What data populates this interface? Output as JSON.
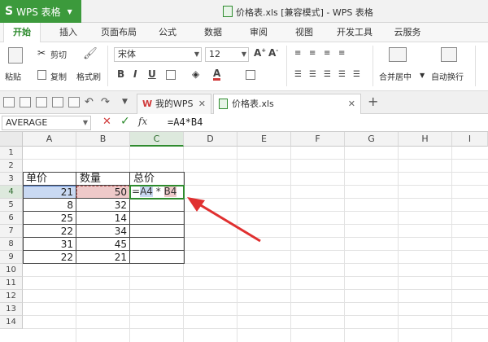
{
  "app": {
    "name": "WPS 表格",
    "window_title": "价格表.xls [兼容模式] - WPS 表格"
  },
  "ribbon_tabs": [
    "开始",
    "插入",
    "页面布局",
    "公式",
    "数据",
    "审阅",
    "视图",
    "开发工具",
    "云服务"
  ],
  "toolbar": {
    "cut": "剪切",
    "paste": "粘贴",
    "copy": "复制",
    "format_painter": "格式刷",
    "font_name": "宋体",
    "font_size": "12",
    "bold": "B",
    "italic": "I",
    "underline": "U",
    "merge_center": "合并居中",
    "wrap_text": "自动换行"
  },
  "doc_tabs": {
    "home": "我的WPS",
    "file": "价格表.xls"
  },
  "formula_bar": {
    "name_box": "AVERAGE",
    "cancel": "✕",
    "confirm": "✓",
    "fx": "fx",
    "formula": "=A4*B4"
  },
  "columns": [
    "A",
    "B",
    "C",
    "D",
    "E",
    "F",
    "G",
    "H",
    "I"
  ],
  "rows": [
    "1",
    "2",
    "3",
    "4",
    "5",
    "6",
    "7",
    "8",
    "9",
    "10",
    "11",
    "12",
    "13",
    "14"
  ],
  "table": {
    "headers": [
      "单价",
      "数量",
      "总价"
    ],
    "data": [
      [
        "21",
        "50"
      ],
      [
        "8",
        "32"
      ],
      [
        "25",
        "14"
      ],
      [
        "22",
        "34"
      ],
      [
        "31",
        "45"
      ],
      [
        "22",
        "21"
      ]
    ],
    "editing_formula": {
      "prefix": "=",
      "ref_a": "A4",
      "op": " * ",
      "ref_b": "B4"
    }
  },
  "colors": {
    "brand_green": "#3c9a3c",
    "ref_a_highlight": "#c9d9f2",
    "ref_b_highlight": "#eec9c9",
    "arrow": "#e03030"
  }
}
